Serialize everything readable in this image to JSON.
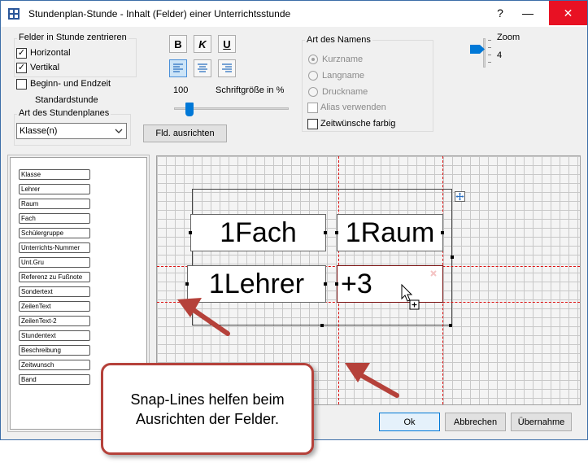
{
  "window": {
    "title": "Stundenplan-Stunde - Inhalt (Felder) einer Unterrichtsstunde",
    "controls": {
      "help": "?",
      "minimize": "—",
      "maximize": "☐",
      "close": "✕"
    }
  },
  "center_group": {
    "label": "Felder in Stunde zentrieren",
    "horizontal": {
      "label": "Horizontal",
      "checked": true
    },
    "vertical": {
      "label": "Vertikal",
      "checked": true
    }
  },
  "options": {
    "begin_end": {
      "label": "Beginn- und Endzeit",
      "checked": false
    },
    "standardstunde": {
      "label": "Standardstunde"
    }
  },
  "plan_type": {
    "label": "Art des Stundenplanes",
    "selected": "Klasse(n)"
  },
  "format": {
    "bold": "B",
    "italic": "K",
    "underline": "U",
    "font_size_value": "100",
    "font_size_label": "Schriftgröße in %",
    "font_size_percent": 100,
    "align_button": "Fld. ausrichten"
  },
  "name_type": {
    "label": "Art des Namens",
    "options": [
      "Kurzname",
      "Langname",
      "Druckname"
    ],
    "selected": "Kurzname",
    "alias": {
      "label": "Alias verwenden",
      "checked": false
    },
    "zeitwuensche": {
      "label": "Zeitwünsche farbig",
      "checked": false
    }
  },
  "zoom": {
    "label": "Zoom",
    "value": "4"
  },
  "field_list": [
    "Klasse",
    "Lehrer",
    "Raum",
    "Fach",
    "Schülergruppe",
    "Unterrichts-Nummer",
    "Unt.Gru",
    "Referenz zu Fußnote",
    "Sondertext",
    "ZeilenText",
    "ZeilenText-2",
    "Stundentext",
    "Beschreibung",
    "Zeitwunsch",
    "Band"
  ],
  "canvas_fields": {
    "fach": "1Fach",
    "raum": "1Raum",
    "lehrer": "1Lehrer",
    "plus": "+3"
  },
  "buttons": {
    "ok": "Ok",
    "abbrechen": "Abbrechen",
    "uebernahme": "Übernahme"
  },
  "callout": {
    "text": "Snap-Lines helfen beim Ausrichten der Felder."
  },
  "colors": {
    "snap_line": "#dd1111",
    "annotation": "#b5413a",
    "close_button": "#e81123",
    "slider": "#0078d7"
  }
}
